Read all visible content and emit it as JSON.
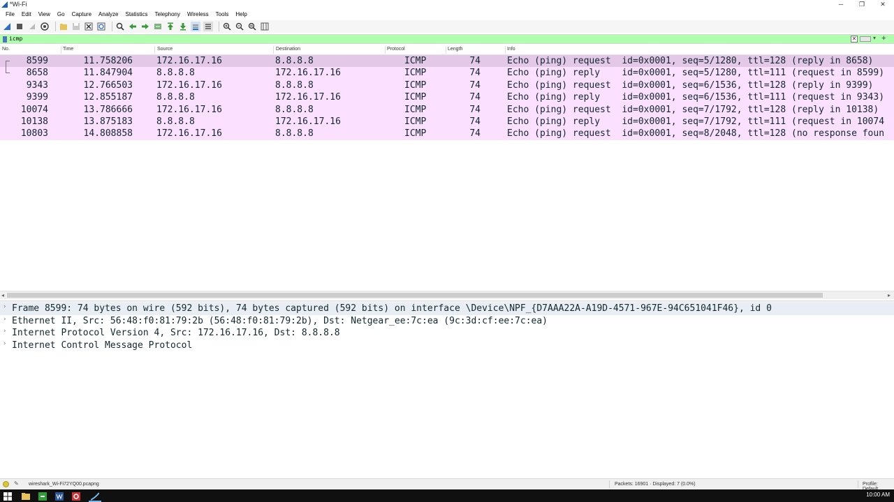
{
  "window": {
    "title": "*Wi-Fi",
    "controls": [
      "─",
      "❐",
      "✕"
    ]
  },
  "menu": [
    "File",
    "Edit",
    "View",
    "Go",
    "Capture",
    "Analyze",
    "Statistics",
    "Telephony",
    "Wireless",
    "Tools",
    "Help"
  ],
  "filter": {
    "value": "icmp",
    "clear_glyph": "✕",
    "dropdown_glyph": "▾",
    "add_glyph": "+"
  },
  "columns": [
    "No.",
    "Time",
    "Source",
    "Destination",
    "Protocol",
    "Length",
    "Info"
  ],
  "packets": [
    {
      "no": "8599",
      "time": "11.758206",
      "src": "172.16.17.16",
      "dst": "8.8.8.8",
      "proto": "ICMP",
      "len": "74",
      "info": "Echo (ping) request  id=0x0001, seq=5/1280, ttl=128 (reply in 8658)"
    },
    {
      "no": "8658",
      "time": "11.847904",
      "src": "8.8.8.8",
      "dst": "172.16.17.16",
      "proto": "ICMP",
      "len": "74",
      "info": "Echo (ping) reply    id=0x0001, seq=5/1280, ttl=111 (request in 8599)"
    },
    {
      "no": "9343",
      "time": "12.766503",
      "src": "172.16.17.16",
      "dst": "8.8.8.8",
      "proto": "ICMP",
      "len": "74",
      "info": "Echo (ping) request  id=0x0001, seq=6/1536, ttl=128 (reply in 9399)"
    },
    {
      "no": "9399",
      "time": "12.855187",
      "src": "8.8.8.8",
      "dst": "172.16.17.16",
      "proto": "ICMP",
      "len": "74",
      "info": "Echo (ping) reply    id=0x0001, seq=6/1536, ttl=111 (request in 9343)"
    },
    {
      "no": "10074",
      "time": "13.786666",
      "src": "172.16.17.16",
      "dst": "8.8.8.8",
      "proto": "ICMP",
      "len": "74",
      "info": "Echo (ping) request  id=0x0001, seq=7/1792, ttl=128 (reply in 10138)"
    },
    {
      "no": "10138",
      "time": "13.875183",
      "src": "8.8.8.8",
      "dst": "172.16.17.16",
      "proto": "ICMP",
      "len": "74",
      "info": "Echo (ping) reply    id=0x0001, seq=7/1792, ttl=111 (request in 10074"
    },
    {
      "no": "10803",
      "time": "14.808858",
      "src": "172.16.17.16",
      "dst": "8.8.8.8",
      "proto": "ICMP",
      "len": "74",
      "info": "Echo (ping) request  id=0x0001, seq=8/2048, ttl=128 (no response foun"
    }
  ],
  "details": [
    "Frame 8599: 74 bytes on wire (592 bits), 74 bytes captured (592 bits) on interface \\Device\\NPF_{D7AAA22A-A19D-4571-967E-94C651041F46}, id 0",
    "Ethernet II, Src: 56:48:f0:81:79:2b (56:48:f0:81:79:2b), Dst: Netgear_ee:7c:ea (9c:3d:cf:ee:7c:ea)",
    "Internet Protocol Version 4, Src: 172.16.17.16, Dst: 8.8.8.8",
    "Internet Control Message Protocol"
  ],
  "expander_glyph": "›",
  "status": {
    "file": "wireshark_Wi-Fi72YQ00.pcapng",
    "packets": "Packets: 16901 · Displayed: 7 (0.0%)",
    "profile": "Profile: Default"
  },
  "taskbar": {
    "clock": "10:00 AM"
  },
  "colors": {
    "icmp_row": "#fce0ff",
    "selected_row": "#e3c8e8",
    "filter_ok": "#afffaf",
    "taskbar": "#101010"
  }
}
